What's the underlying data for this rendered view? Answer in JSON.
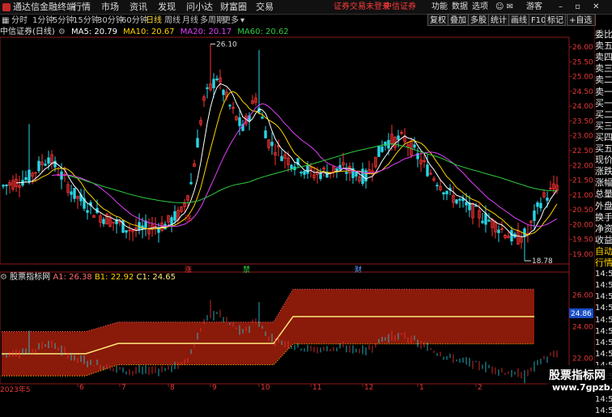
{
  "app": {
    "title": "通达信金融终端",
    "menus": [
      "行情",
      "市场",
      "资讯",
      "发现",
      "问小达",
      "财富圈",
      "交易"
    ],
    "warning": "证券交易未登录",
    "broker": "中信证券",
    "right": [
      "功能",
      "数据",
      "选项",
      "游客"
    ]
  },
  "periods": [
    "分时",
    "1分钟",
    "5分钟",
    "15分钟",
    "30分钟",
    "60分钟",
    "日线",
    "周线",
    "月线",
    "多周期",
    "更多"
  ],
  "active_period": "日线",
  "right_buttons": [
    "复权",
    "叠加",
    "多股",
    "统计",
    "画线",
    "F10",
    "标记",
    "+自选"
  ],
  "main_legend": {
    "stock": "中信证券(日线)",
    "ma5": "MA5: 20.79",
    "ma10": "MA10: 20.67",
    "ma20": "MA20: 20.17",
    "ma60": "MA60: 20.62"
  },
  "price_axis": [
    "26.00",
    "25.50",
    "25.00",
    "24.50",
    "24.00",
    "23.50",
    "23.00",
    "22.50",
    "22.00",
    "21.50",
    "21.00",
    "20.50",
    "20.00",
    "19.50",
    "19.00"
  ],
  "annotations": {
    "high": "26.10",
    "low": "18.78",
    "tag1": "涨",
    "tag2": "禁",
    "tag3": "财"
  },
  "side_labels": [
    "委比",
    "卖五",
    "卖四",
    "卖三",
    "卖二",
    "卖一",
    "买一",
    "买二",
    "买三",
    "买四",
    "买五",
    "现价",
    "涨跌",
    "涨幅",
    "总量",
    "外盘",
    "换手",
    "净资",
    "收益",
    "自动",
    "行情",
    "14:56",
    "14:56",
    "14:56",
    "14:56",
    "14:56",
    "14:56",
    "14:56",
    "14:56",
    "14:56",
    "14:56",
    "14:56",
    "14:56",
    "14:56"
  ],
  "indicator_legend": {
    "name": "股票指标网",
    "a1": "A1: 26.38",
    "b1": "B1: 22.92",
    "c1": "C1: 24.65"
  },
  "indicator_axis": [
    "26.00",
    "24.00",
    "22.00"
  ],
  "indicator_marker": "24.86",
  "x_axis": [
    "2023年5",
    "6",
    "7",
    "8",
    "9",
    "10",
    "11",
    "12",
    "1",
    "2"
  ],
  "watermark": {
    "text": "股票指标网",
    "url": "www.7gpzb.com"
  },
  "colors": {
    "ma5": "#ffffff",
    "ma10": "#ffd400",
    "ma20": "#e040fb",
    "ma60": "#2ecc40",
    "up": "#ff3333",
    "down": "#29d6e6",
    "band": "#8a1a0a"
  }
}
